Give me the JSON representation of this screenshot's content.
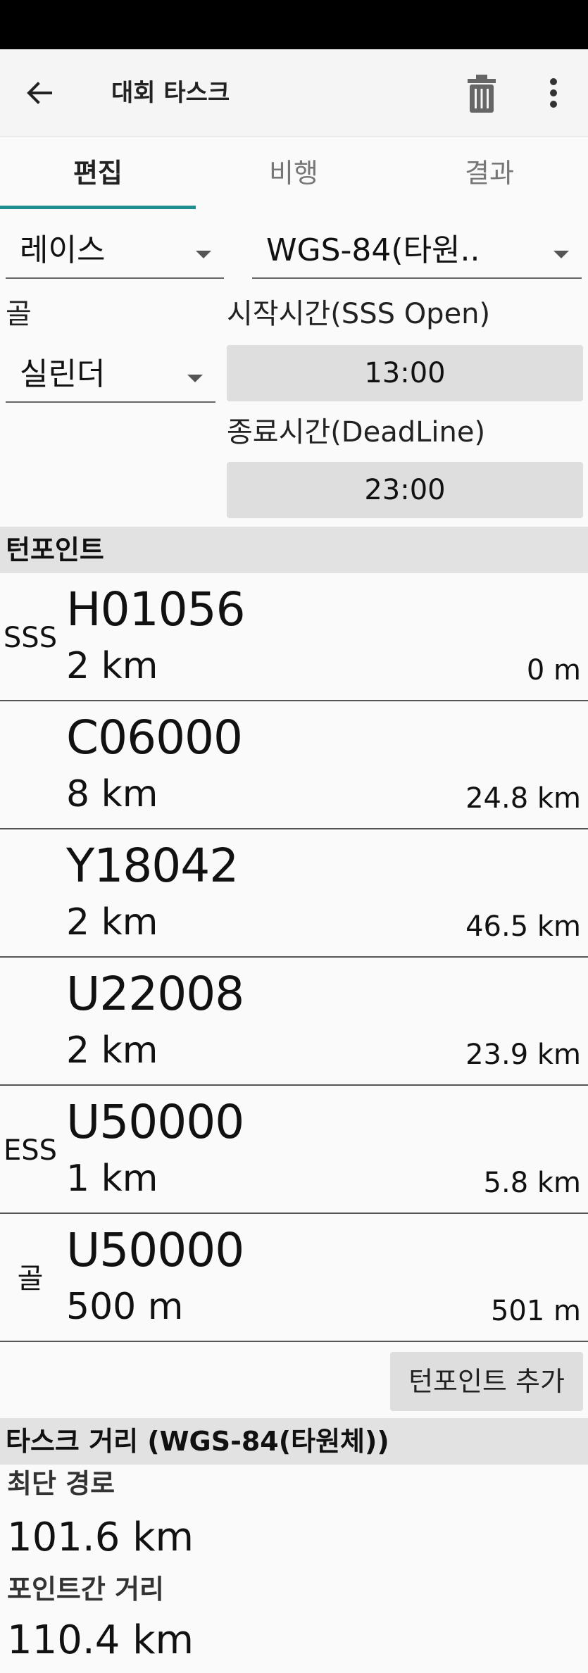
{
  "appbar": {
    "title": "대회 타스크",
    "back_icon": "arrow-left-icon",
    "delete_icon": "trash-icon",
    "more_icon": "more-vert-icon"
  },
  "tabs": [
    {
      "label": "편집",
      "active": true
    },
    {
      "label": "비행",
      "active": false
    },
    {
      "label": "결과",
      "active": false
    }
  ],
  "settings": {
    "task_type": "레이스",
    "coord_system": "WGS-84(타원..",
    "goal_label": "골",
    "goal_type": "실린더",
    "start_label": "시작시간(SSS Open)",
    "start_time": "13:00",
    "end_label": "종료시간(DeadLine)",
    "end_time": "23:00"
  },
  "turnpoints": {
    "header": "턴포인트",
    "items": [
      {
        "kind": "SSS",
        "name": "H01056",
        "radius": "2 km",
        "distance": "0 m"
      },
      {
        "kind": "",
        "name": "C06000",
        "radius": "8 km",
        "distance": "24.8 km"
      },
      {
        "kind": "",
        "name": "Y18042",
        "radius": "2 km",
        "distance": "46.5 km"
      },
      {
        "kind": "",
        "name": "U22008",
        "radius": "2 km",
        "distance": "23.9 km"
      },
      {
        "kind": "ESS",
        "name": "U50000",
        "radius": "1 km",
        "distance": "5.8 km"
      },
      {
        "kind": "골",
        "name": "U50000",
        "radius": "500 m",
        "distance": "501 m"
      }
    ],
    "add_button": "턴포인트 추가"
  },
  "task_distance": {
    "header": "타스크 거리 (WGS-84(타원체))",
    "shortest_label": "최단 경로",
    "shortest_value": "101.6 km",
    "point_label": "포인트간 거리",
    "point_value": "110.4 km"
  },
  "colors": {
    "accent": "#1e8e8e",
    "section_bg": "#e2e2e2",
    "button_bg": "#dedede"
  }
}
